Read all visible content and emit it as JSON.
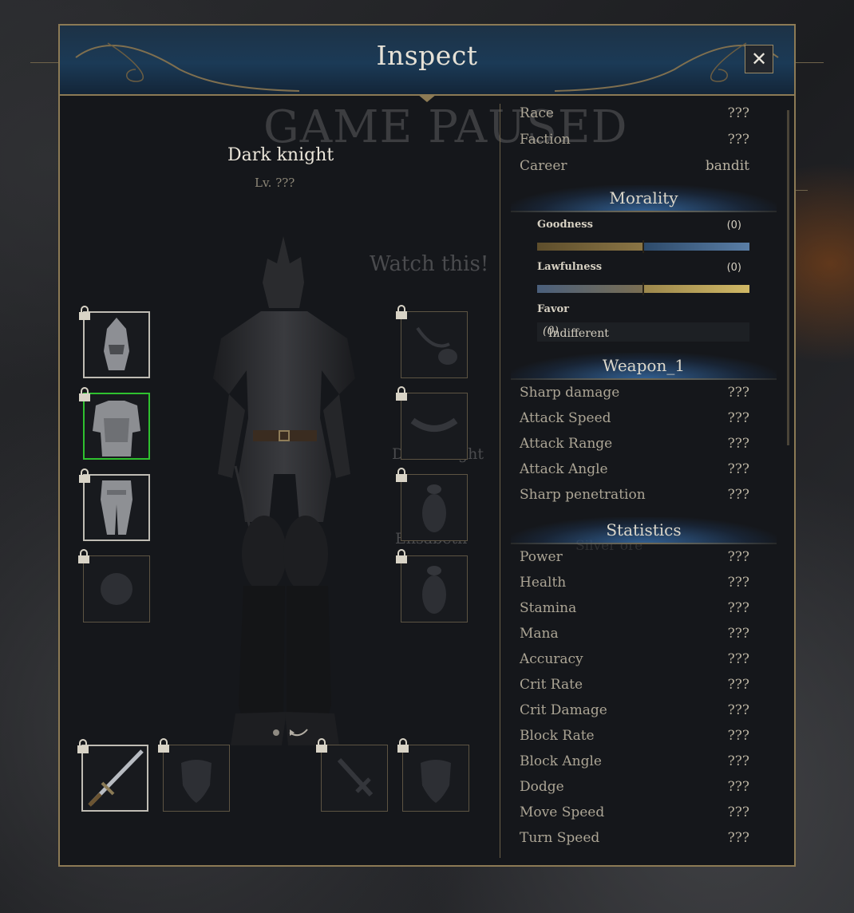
{
  "window": {
    "title": "Inspect",
    "close_label": "✕"
  },
  "background": {
    "ghost_text": [
      "GAME PAUSED",
      "Watch this!",
      "Dark knight",
      "Elisabeth",
      "Silver ore"
    ]
  },
  "character": {
    "name": "Dark knight",
    "level": "Lv. ???"
  },
  "info_rows": [
    {
      "label": "Race",
      "value": "???"
    },
    {
      "label": "Faction",
      "value": "???"
    },
    {
      "label": "Career",
      "value": "bandit"
    }
  ],
  "morality": {
    "title": "Morality",
    "goodness": {
      "label": "Goodness",
      "value": "(0)",
      "level": 0.5
    },
    "lawfulness": {
      "label": "Lawfulness",
      "value": "(0)",
      "level": 0.5
    },
    "favor": {
      "label": "Favor",
      "value": "Indifferent",
      "value_suffix": "(0)"
    }
  },
  "weapon": {
    "title": "Weapon_1",
    "rows": [
      {
        "label": "Sharp damage",
        "value": "???"
      },
      {
        "label": "Attack Speed",
        "value": "???"
      },
      {
        "label": "Attack Range",
        "value": "???"
      },
      {
        "label": "Attack Angle",
        "value": "???"
      },
      {
        "label": "Sharp penetration",
        "value": "???"
      }
    ]
  },
  "statistics": {
    "title": "Statistics",
    "rows": [
      {
        "label": "Power",
        "value": "???"
      },
      {
        "label": "Health",
        "value": "???"
      },
      {
        "label": "Stamina",
        "value": "???"
      },
      {
        "label": "Mana",
        "value": "???"
      },
      {
        "label": "Accuracy",
        "value": "???"
      },
      {
        "label": "Crit Rate",
        "value": "???"
      },
      {
        "label": "Crit Damage",
        "value": "???"
      },
      {
        "label": "Block Rate",
        "value": "???"
      },
      {
        "label": "Block Angle",
        "value": "???"
      },
      {
        "label": "Dodge",
        "value": "???"
      },
      {
        "label": "Move Speed",
        "value": "???"
      },
      {
        "label": "Turn Speed",
        "value": "???"
      }
    ]
  },
  "equipment_slots": {
    "left": [
      "helmet-icon",
      "chest-armor-icon",
      "leg-armor-icon",
      "ring-icon"
    ],
    "right": [
      "amulet-icon",
      "belt-icon",
      "accessory-icon",
      "accessory-icon"
    ],
    "bottom": [
      "sword-icon",
      "shield-icon",
      "sword-icon",
      "shield-icon"
    ]
  },
  "colors": {
    "accent_gold": "#8c7a55",
    "header_blue": "#1b3a56",
    "selected_slot": "#2fc12f",
    "goodness_bar": "#4a6f96",
    "lawfulness_bar": "#c2a957"
  }
}
